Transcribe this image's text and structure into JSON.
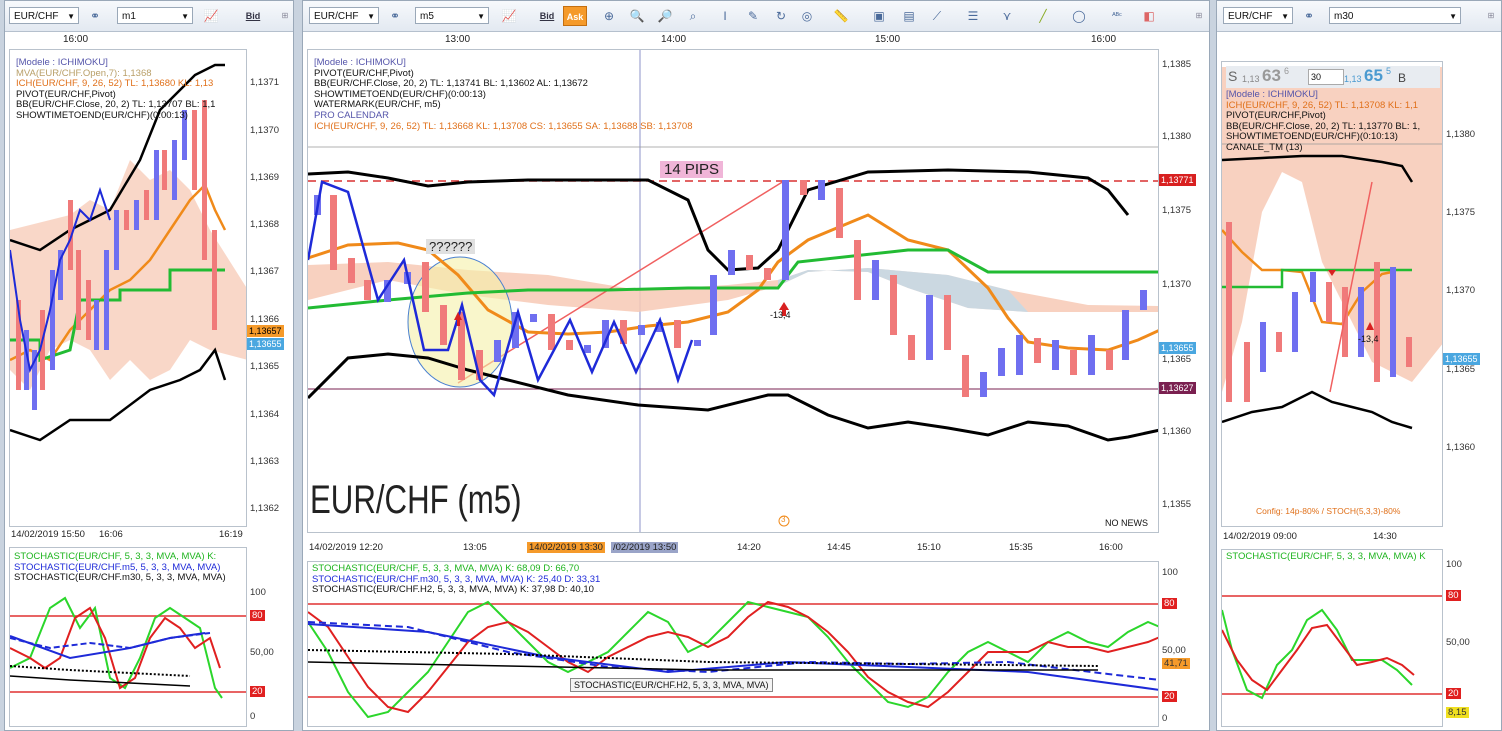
{
  "colors": {
    "accent_orange": "#f59a2a",
    "bull": "#6f6ff0",
    "bear": "#f07a7a",
    "cloud": "#f7c9b5"
  },
  "left": {
    "symbol": "EUR/CHF",
    "timeframe": "m1",
    "bid_label": "Bid",
    "time_label": "16:00",
    "legend": [
      "[Modele : ICHIMOKU]",
      "MVA(EUR/CHF.Open,7): 1,1368",
      "ICH(EUR/CHF, 9, 26, 52)  TL: 1,13680  KL: 1,13",
      "PIVOT(EUR/CHF,Pivot)",
      "BB(EUR/CHF.Close, 20, 2)  TL: 1,13707  BL: 1,1",
      "SHOWTIMETOEND(EUR/CHF)(0:00:13)"
    ],
    "yticks": [
      "1,1371",
      "1,1370",
      "1,1369",
      "1,1368",
      "1,1367",
      "1,1366",
      "1,1365",
      "1,1364",
      "1,1363",
      "1,1362"
    ],
    "price_tags": [
      "1,13657",
      "1,13655"
    ],
    "xticks": [
      "14/02/2019 15:50",
      "16:06",
      "16:19"
    ],
    "stoch_legend": [
      "STOCHASTIC(EUR/CHF, 5, 3, 3, MVA, MVA)  K:",
      "STOCHASTIC(EUR/CHF.m5, 5, 3, 3, MVA, MVA)",
      "STOCHASTIC(EUR/CHF.m30, 5, 3, 3, MVA, MVA)"
    ],
    "stoch_ticks": [
      "100",
      "80",
      "50,00",
      "20",
      "0"
    ]
  },
  "mid": {
    "symbol": "EUR/CHF",
    "timeframe": "m5",
    "bid_label": "Bid",
    "ask_label": "Ask",
    "time_labels": [
      "13:00",
      "14:00",
      "15:00",
      "16:00"
    ],
    "legend": [
      "[Modele : ICHIMOKU]",
      "PIVOT(EUR/CHF,Pivot)",
      "BB(EUR/CHF.Close, 20, 2)  TL: 1,13741  BL: 1,13602  AL: 1,13672",
      "SHOWTIMETOEND(EUR/CHF)(0:00:13)",
      "WATERMARK(EUR/CHF, m5)",
      "PRO CALENDAR",
      "ICH(EUR/CHF, 9, 26, 52)  TL: 1,13668  KL: 1,13708  CS: 1,13655  SA: 1,13688  SB: 1,13708"
    ],
    "yticks": [
      "1,1385",
      "1,1380",
      "1,1375",
      "1,1370",
      "1,1365",
      "1,1360",
      "1,1355"
    ],
    "price_tags": [
      "1,13771",
      "1,13655",
      "1,13627"
    ],
    "pips_label": "14 PIPS",
    "question_label": "??????",
    "arrow_label": "-13,4",
    "watermark": "EUR/CHF (m5)",
    "no_news": "NO NEWS",
    "event_marker": "3",
    "xticks": [
      "14/02/2019 12:20",
      "13:05",
      "14:20",
      "14:45",
      "15:10",
      "15:35",
      "16:00"
    ],
    "cursor_time_a": "14/02/2019 13:30",
    "cursor_time_b": "/02/2019 13:50",
    "stoch_legend": [
      "STOCHASTIC(EUR/CHF, 5, 3, 3, MVA, MVA)  K: 68,09  D: 66,70",
      "STOCHASTIC(EUR/CHF.m30, 5, 3, 3, MVA, MVA)  K: 25,40  D: 33,31",
      "STOCHASTIC(EUR/CHF.H2, 5, 3, 3, MVA, MVA)  K: 37,98  D: 40,10"
    ],
    "stoch_ticks": [
      "100",
      "80",
      "50,00",
      "20",
      "0"
    ],
    "stoch_tag": "41,71",
    "tooltip": "STOCHASTIC(EUR/CHF.H2, 5, 3, 3, MVA, MVA)"
  },
  "right": {
    "symbol": "EUR/CHF",
    "timeframe": "m30",
    "sell_label": "S",
    "sell_small": "1,13",
    "sell_big": "63",
    "sell_sup": "6",
    "lot": "30",
    "buy_small": "1,13",
    "buy_big": "65",
    "buy_sup": "5",
    "buy_label": "B",
    "legend": [
      "[Modele : ICHIMOKU]",
      "ICH(EUR/CHF, 9, 26, 52)  TL: 1,13708  KL: 1,1",
      "PIVOT(EUR/CHF,Pivot)",
      "BB(EUR/CHF.Close, 20, 2)  TL: 1,13770  BL: 1,",
      "SHOWTIMETOEND(EUR/CHF)(0:10:13)",
      "CANALE_TM (13)"
    ],
    "yticks": [
      "1,1380",
      "1,1375",
      "1,1370",
      "1,1365",
      "1,1360"
    ],
    "price_tag": "1,13655",
    "arrow_label": "-13,4",
    "config": "Config: 14p-80% / STOCH(5,3,3)-80%",
    "xticks": [
      "14/02/2019 09:00",
      "14:30"
    ],
    "stoch_legend": [
      "STOCHASTIC(EUR/CHF, 5, 3, 3, MVA, MVA)  K"
    ],
    "stoch_ticks": [
      "100",
      "80",
      "50,00",
      "20"
    ],
    "stoch_tag": "8,15"
  }
}
